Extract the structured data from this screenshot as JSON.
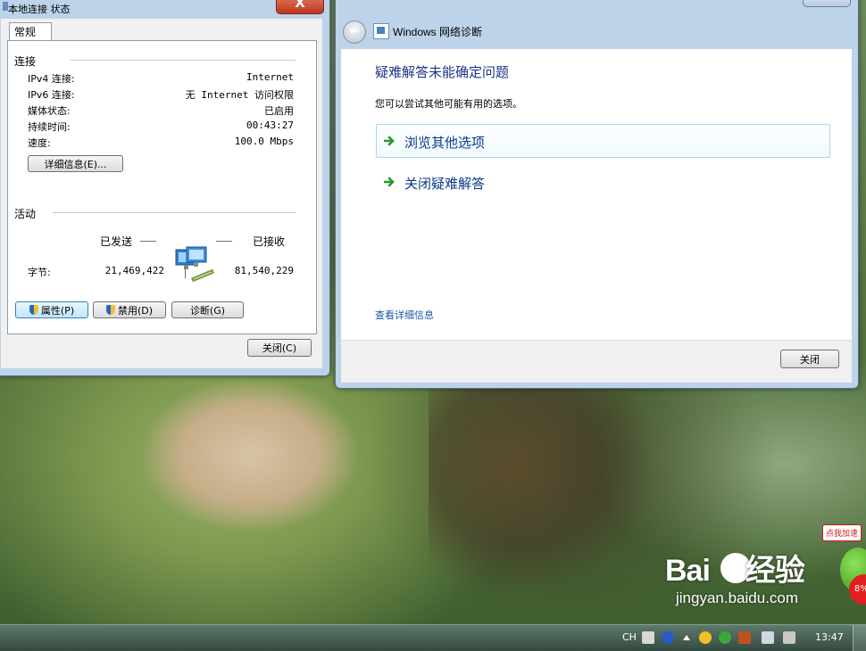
{
  "status_window": {
    "title": "本地连接 状态",
    "close_glyph": "X",
    "tab_general": "常规",
    "connection_section": "连接",
    "rows": [
      {
        "label": "IPv4 连接:",
        "value": "Internet"
      },
      {
        "label": "IPv6 连接:",
        "value": "无 Internet 访问权限"
      },
      {
        "label": "媒体状态:",
        "value": "已启用"
      },
      {
        "label": "持续时间:",
        "value": "00:43:27"
      },
      {
        "label": "速度:",
        "value": "100.0 Mbps"
      }
    ],
    "details_button": "详细信息(E)...",
    "activity_section": "活动",
    "sent_label": "已发送",
    "received_label": "已接收",
    "bytes_label": "字节:",
    "bytes_sent": "21,469,422",
    "bytes_received": "81,540,229",
    "properties_button": "属性(P)",
    "disable_button": "禁用(D)",
    "diagnose_button": "诊断(G)",
    "close_button": "关闭(C)"
  },
  "diag_window": {
    "title": "Windows 网络诊断",
    "heading": "疑难解答未能确定问题",
    "subtext": "您可以尝试其他可能有用的选项。",
    "options": [
      {
        "label": "浏览其他选项"
      },
      {
        "label": "关闭疑难解答"
      }
    ],
    "details_link": "查看详细信息",
    "close_button": "关闭"
  },
  "taskbar": {
    "language": "CH",
    "clock": "13:47"
  },
  "watermark": {
    "logo": "Bai",
    "logo_suffix": "经验",
    "url": "jingyan.baidu.com"
  },
  "accelerator": {
    "tag": "点我加速",
    "badge": "8%"
  },
  "colors": {
    "heading_blue": "#1e3287",
    "option_blue": "#0a3a88",
    "link_blue": "#1a5aa8",
    "arrow_green": "#2a9a2a"
  }
}
